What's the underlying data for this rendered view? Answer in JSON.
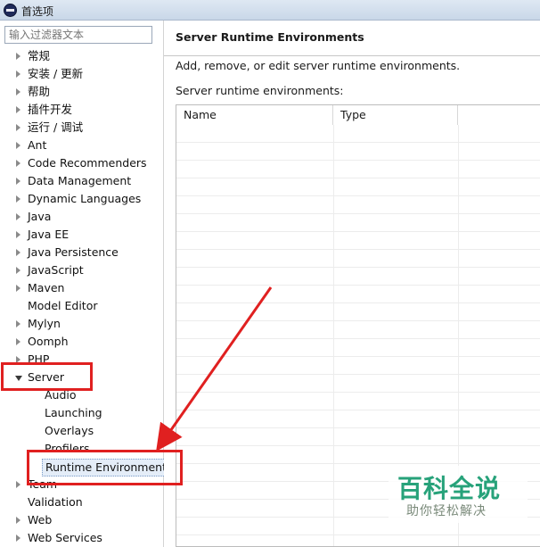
{
  "window": {
    "title": "首选项"
  },
  "filter": {
    "placeholder": "输入过滤器文本"
  },
  "tree": {
    "items": [
      {
        "label": "常规",
        "arrow": "closed"
      },
      {
        "label": "安装 / 更新",
        "arrow": "closed"
      },
      {
        "label": "帮助",
        "arrow": "closed"
      },
      {
        "label": "插件开发",
        "arrow": "closed"
      },
      {
        "label": "运行 / 调试",
        "arrow": "closed"
      },
      {
        "label": "Ant",
        "arrow": "closed"
      },
      {
        "label": "Code Recommenders",
        "arrow": "closed"
      },
      {
        "label": "Data Management",
        "arrow": "closed"
      },
      {
        "label": "Dynamic Languages",
        "arrow": "closed"
      },
      {
        "label": "Java",
        "arrow": "closed"
      },
      {
        "label": "Java EE",
        "arrow": "closed"
      },
      {
        "label": "Java Persistence",
        "arrow": "closed"
      },
      {
        "label": "JavaScript",
        "arrow": "closed"
      },
      {
        "label": "Maven",
        "arrow": "closed"
      },
      {
        "label": "Model Editor",
        "arrow": "none"
      },
      {
        "label": "Mylyn",
        "arrow": "closed"
      },
      {
        "label": "Oomph",
        "arrow": "closed"
      },
      {
        "label": "PHP",
        "arrow": "closed"
      },
      {
        "label": "Server",
        "arrow": "open"
      },
      {
        "label": "Audio",
        "arrow": "none",
        "child": true
      },
      {
        "label": "Launching",
        "arrow": "none",
        "child": true
      },
      {
        "label": "Overlays",
        "arrow": "none",
        "child": true
      },
      {
        "label": "Profilers",
        "arrow": "none",
        "child": true
      },
      {
        "label": "Runtime Environment",
        "arrow": "none",
        "child": true,
        "selected": true
      },
      {
        "label": "Team",
        "arrow": "closed"
      },
      {
        "label": "Validation",
        "arrow": "none"
      },
      {
        "label": "Web",
        "arrow": "closed"
      },
      {
        "label": "Web Services",
        "arrow": "closed"
      }
    ]
  },
  "page": {
    "title": "Server Runtime Environments",
    "description": "Add, remove, or edit server runtime environments.",
    "list_label": "Server runtime environments:",
    "columns": [
      "Name",
      "Type"
    ]
  },
  "watermark": {
    "title": "百科全说",
    "subtitle": "助你轻松解决"
  },
  "colors": {
    "highlight": "#e02020",
    "watermark": "#27a27a"
  }
}
